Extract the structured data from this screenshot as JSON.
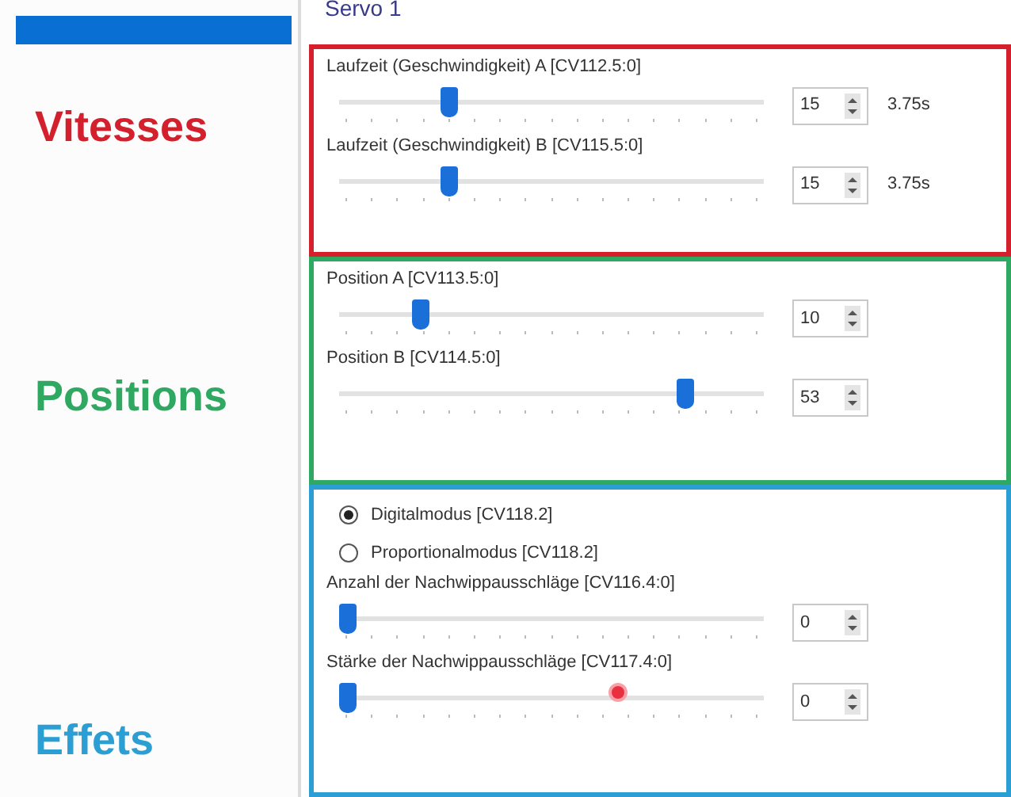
{
  "panel": {
    "title": "Servo 1"
  },
  "groups": [
    {
      "label": "Vitesses",
      "color": "#d4202c",
      "items": [
        {
          "kind": "slider",
          "label": "Laufzeit (Geschwindigkeit) A [CV112.5:0]",
          "level": 0.25,
          "value": "15",
          "reading": "3.75s"
        },
        {
          "kind": "slider",
          "label": "Laufzeit (Geschwindigkeit) B [CV115.5:0]",
          "level": 0.25,
          "value": "15",
          "reading": "3.75s"
        }
      ]
    },
    {
      "label": "Positions",
      "color": "#2fa862",
      "items": [
        {
          "kind": "slider",
          "label": "Position A [CV113.5:0]",
          "level": 0.18,
          "value": "10"
        },
        {
          "kind": "slider",
          "label": "Position B [CV114.5:0]",
          "level": 0.83,
          "value": "53"
        }
      ]
    },
    {
      "label": "Effets",
      "color": "#2b9fd3",
      "items": [
        {
          "kind": "radio",
          "label": "Digitalmodus [CV118.2]",
          "selected": true
        },
        {
          "kind": "radio",
          "label": "Proportionalmodus [CV118.2]",
          "selected": false
        },
        {
          "kind": "slider",
          "label": "Anzahl der Nachwippausschläge [CV116.4:0]",
          "level": 0,
          "value": "0"
        },
        {
          "kind": "slider",
          "label": "Stärke der Nachwippausschläge [CV117.4:0]",
          "level": 0,
          "value": "0"
        }
      ]
    }
  ]
}
